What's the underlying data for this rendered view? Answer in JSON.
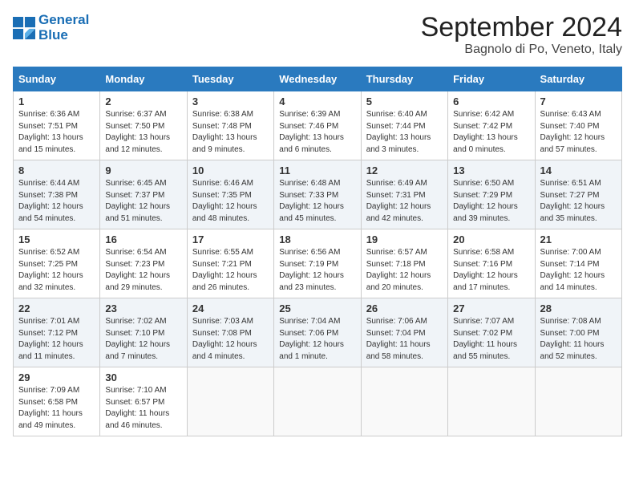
{
  "logo": {
    "line1": "General",
    "line2": "Blue"
  },
  "title": "September 2024",
  "location": "Bagnolo di Po, Veneto, Italy",
  "days_of_week": [
    "Sunday",
    "Monday",
    "Tuesday",
    "Wednesday",
    "Thursday",
    "Friday",
    "Saturday"
  ],
  "weeks": [
    [
      {
        "day": "1",
        "sunrise": "Sunrise: 6:36 AM",
        "sunset": "Sunset: 7:51 PM",
        "daylight": "Daylight: 13 hours and 15 minutes."
      },
      {
        "day": "2",
        "sunrise": "Sunrise: 6:37 AM",
        "sunset": "Sunset: 7:50 PM",
        "daylight": "Daylight: 13 hours and 12 minutes."
      },
      {
        "day": "3",
        "sunrise": "Sunrise: 6:38 AM",
        "sunset": "Sunset: 7:48 PM",
        "daylight": "Daylight: 13 hours and 9 minutes."
      },
      {
        "day": "4",
        "sunrise": "Sunrise: 6:39 AM",
        "sunset": "Sunset: 7:46 PM",
        "daylight": "Daylight: 13 hours and 6 minutes."
      },
      {
        "day": "5",
        "sunrise": "Sunrise: 6:40 AM",
        "sunset": "Sunset: 7:44 PM",
        "daylight": "Daylight: 13 hours and 3 minutes."
      },
      {
        "day": "6",
        "sunrise": "Sunrise: 6:42 AM",
        "sunset": "Sunset: 7:42 PM",
        "daylight": "Daylight: 13 hours and 0 minutes."
      },
      {
        "day": "7",
        "sunrise": "Sunrise: 6:43 AM",
        "sunset": "Sunset: 7:40 PM",
        "daylight": "Daylight: 12 hours and 57 minutes."
      }
    ],
    [
      {
        "day": "8",
        "sunrise": "Sunrise: 6:44 AM",
        "sunset": "Sunset: 7:38 PM",
        "daylight": "Daylight: 12 hours and 54 minutes."
      },
      {
        "day": "9",
        "sunrise": "Sunrise: 6:45 AM",
        "sunset": "Sunset: 7:37 PM",
        "daylight": "Daylight: 12 hours and 51 minutes."
      },
      {
        "day": "10",
        "sunrise": "Sunrise: 6:46 AM",
        "sunset": "Sunset: 7:35 PM",
        "daylight": "Daylight: 12 hours and 48 minutes."
      },
      {
        "day": "11",
        "sunrise": "Sunrise: 6:48 AM",
        "sunset": "Sunset: 7:33 PM",
        "daylight": "Daylight: 12 hours and 45 minutes."
      },
      {
        "day": "12",
        "sunrise": "Sunrise: 6:49 AM",
        "sunset": "Sunset: 7:31 PM",
        "daylight": "Daylight: 12 hours and 42 minutes."
      },
      {
        "day": "13",
        "sunrise": "Sunrise: 6:50 AM",
        "sunset": "Sunset: 7:29 PM",
        "daylight": "Daylight: 12 hours and 39 minutes."
      },
      {
        "day": "14",
        "sunrise": "Sunrise: 6:51 AM",
        "sunset": "Sunset: 7:27 PM",
        "daylight": "Daylight: 12 hours and 35 minutes."
      }
    ],
    [
      {
        "day": "15",
        "sunrise": "Sunrise: 6:52 AM",
        "sunset": "Sunset: 7:25 PM",
        "daylight": "Daylight: 12 hours and 32 minutes."
      },
      {
        "day": "16",
        "sunrise": "Sunrise: 6:54 AM",
        "sunset": "Sunset: 7:23 PM",
        "daylight": "Daylight: 12 hours and 29 minutes."
      },
      {
        "day": "17",
        "sunrise": "Sunrise: 6:55 AM",
        "sunset": "Sunset: 7:21 PM",
        "daylight": "Daylight: 12 hours and 26 minutes."
      },
      {
        "day": "18",
        "sunrise": "Sunrise: 6:56 AM",
        "sunset": "Sunset: 7:19 PM",
        "daylight": "Daylight: 12 hours and 23 minutes."
      },
      {
        "day": "19",
        "sunrise": "Sunrise: 6:57 AM",
        "sunset": "Sunset: 7:18 PM",
        "daylight": "Daylight: 12 hours and 20 minutes."
      },
      {
        "day": "20",
        "sunrise": "Sunrise: 6:58 AM",
        "sunset": "Sunset: 7:16 PM",
        "daylight": "Daylight: 12 hours and 17 minutes."
      },
      {
        "day": "21",
        "sunrise": "Sunrise: 7:00 AM",
        "sunset": "Sunset: 7:14 PM",
        "daylight": "Daylight: 12 hours and 14 minutes."
      }
    ],
    [
      {
        "day": "22",
        "sunrise": "Sunrise: 7:01 AM",
        "sunset": "Sunset: 7:12 PM",
        "daylight": "Daylight: 12 hours and 11 minutes."
      },
      {
        "day": "23",
        "sunrise": "Sunrise: 7:02 AM",
        "sunset": "Sunset: 7:10 PM",
        "daylight": "Daylight: 12 hours and 7 minutes."
      },
      {
        "day": "24",
        "sunrise": "Sunrise: 7:03 AM",
        "sunset": "Sunset: 7:08 PM",
        "daylight": "Daylight: 12 hours and 4 minutes."
      },
      {
        "day": "25",
        "sunrise": "Sunrise: 7:04 AM",
        "sunset": "Sunset: 7:06 PM",
        "daylight": "Daylight: 12 hours and 1 minute."
      },
      {
        "day": "26",
        "sunrise": "Sunrise: 7:06 AM",
        "sunset": "Sunset: 7:04 PM",
        "daylight": "Daylight: 11 hours and 58 minutes."
      },
      {
        "day": "27",
        "sunrise": "Sunrise: 7:07 AM",
        "sunset": "Sunset: 7:02 PM",
        "daylight": "Daylight: 11 hours and 55 minutes."
      },
      {
        "day": "28",
        "sunrise": "Sunrise: 7:08 AM",
        "sunset": "Sunset: 7:00 PM",
        "daylight": "Daylight: 11 hours and 52 minutes."
      }
    ],
    [
      {
        "day": "29",
        "sunrise": "Sunrise: 7:09 AM",
        "sunset": "Sunset: 6:58 PM",
        "daylight": "Daylight: 11 hours and 49 minutes."
      },
      {
        "day": "30",
        "sunrise": "Sunrise: 7:10 AM",
        "sunset": "Sunset: 6:57 PM",
        "daylight": "Daylight: 11 hours and 46 minutes."
      },
      null,
      null,
      null,
      null,
      null
    ]
  ]
}
